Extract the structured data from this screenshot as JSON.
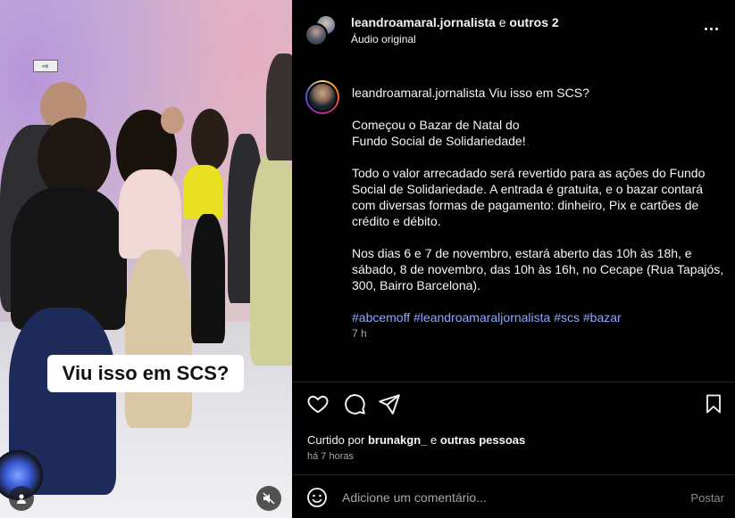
{
  "media": {
    "sticker_text": "Viu isso em SCS?",
    "exit_sign": "⇨"
  },
  "header": {
    "author": "leandroamaral.jornalista",
    "coauthors_connector": "e",
    "coauthors": "outros 2",
    "audio": "Áudio original"
  },
  "caption": {
    "username": "leandroamaral.jornalista",
    "headline": "Viu isso em SCS?",
    "para1_line1": "Começou o Bazar de Natal do",
    "para1_line2": "Fundo Social de Solidariedade!",
    "para2": "Todo o valor arrecadado será revertido para as ações do Fundo Social de Solidariedade. A entrada é gratuita, e o bazar contará com diversas formas de pagamento: dinheiro, Pix e cartões de crédito e débito.",
    "para3": "Nos dias 6 e 7 de novembro, estará aberto das 10h às 18h, e sábado, 8 de novembro, das 10h às 16h, no Cecape (Rua Tapajós, 300, Bairro Barcelona).",
    "hashtags": "#abcemoff #leandroamaraljornalista #scs #bazar",
    "time": "7 h"
  },
  "likes": {
    "prefix": "Curtido por",
    "user": "brunakgn_",
    "connector": "e",
    "others": "outras pessoas",
    "time": "há 7 horas"
  },
  "comment": {
    "placeholder": "Adicione um comentário...",
    "post_label": "Postar"
  },
  "icons": {
    "like": "heart-icon",
    "comment": "comment-icon",
    "share": "share-icon",
    "save": "bookmark-icon",
    "more": "more-icon",
    "emoji": "emoji-icon",
    "mute": "muted-icon",
    "user": "user-icon"
  }
}
